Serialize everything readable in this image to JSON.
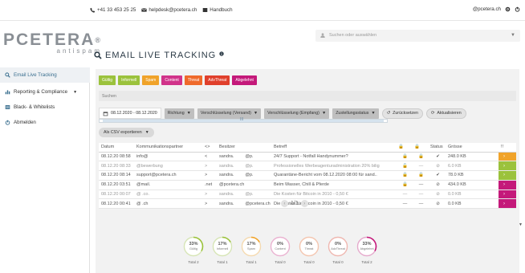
{
  "topbar": {
    "phone": "+41 33 453 25 25",
    "email": "helpdesk@pcetera.ch",
    "manual": "Handbuch",
    "user": "@pcetera.ch"
  },
  "logo": {
    "name": "PCETERA",
    "reg": "®",
    "sub": "antispam"
  },
  "search_select": {
    "placeholder": "Suchen oder auswählen"
  },
  "sidebar": {
    "items": [
      {
        "label": "Email Live Tracking",
        "icon": "search-icon"
      },
      {
        "label": "Reporting & Compliance",
        "icon": "chart-icon"
      },
      {
        "label": "Black- & Whitelists",
        "icon": "list-icon"
      },
      {
        "label": "Abmelden",
        "icon": "power-icon"
      }
    ]
  },
  "page": {
    "title": "EMAIL LIVE TRACKING"
  },
  "chips": [
    {
      "label": "Gültig",
      "color": "#9bc23c"
    },
    {
      "label": "Informell",
      "color": "#9bc23c"
    },
    {
      "label": "Spam",
      "color": "#f0a32a"
    },
    {
      "label": "Content",
      "color": "#d1338a"
    },
    {
      "label": "Threat",
      "color": "#ef6a2b"
    },
    {
      "label": "AdvThreat",
      "color": "#e0402c"
    },
    {
      "label": "Abgelehnt",
      "color": "#c4197a"
    }
  ],
  "search": {
    "placeholder": "Suchen"
  },
  "filters": {
    "date_range": "08.12.2020 - 08.12.2020",
    "direction": "Richtung",
    "enc_send": "Verschlüsselung (Versand)",
    "enc_recv": "Verschlüsselung (Empfang)",
    "delivery_status": "Zustellungsstatus",
    "reset": "Zurücksetzen",
    "refresh": "Aktualisieren",
    "scroll_mark": "III"
  },
  "export": {
    "label": "Als CSV exportieren"
  },
  "table": {
    "headers": [
      "Datum",
      "Kommunikationspartner",
      "<>",
      "Besitzer",
      "Betreff",
      "",
      "",
      "Status",
      "Grösse",
      "!!"
    ],
    "rows": [
      {
        "date": "08.12.20 08:58",
        "partner": "info@",
        "dir": "<",
        "owner": "sandra.",
        "owner_domain": "@p.",
        "subject": "24/7 Support - Notfall Handynummer?",
        "lock1": "🔒",
        "lock2": "🔒",
        "status": "✔",
        "size": "248.0 KB",
        "flag": "#f0a32a",
        "muted": false
      },
      {
        "date": "08.12.20 08:33",
        "partner": "@bewerbung",
        "dir": ">",
        "owner": "sandra.",
        "owner_domain": "@p.",
        "subject": "Professionelles Werbeagenturadministration 20% bilig",
        "lock1": "🔓",
        "lock2": "—",
        "status": "⊘",
        "size": "6.0 KB",
        "flag": "#9bc23c",
        "muted": true
      },
      {
        "date": "08.12.20 08:14",
        "partner": "support@pcetera.ch",
        "dir": ">",
        "owner": "sandra.",
        "owner_domain": "@p.",
        "subject": "Quarantäne-Bericht vom 08.12.2020 08:00 für sand..",
        "lock1": "🔒",
        "lock2": "🔒",
        "status": "✔",
        "size": "78.0 KB",
        "flag": "#9bc23c",
        "muted": false
      },
      {
        "date": "08.12.20 03:51",
        "partner": "@mail.",
        "dir": ".net",
        "owner": "@pcetera.ch",
        "owner_domain": "",
        "subject": "Beim Wasser, Chill & Pferde",
        "lock1": "🔒",
        "lock2": "—",
        "status": "⊘",
        "size": "434.0 KB",
        "flag": "#c4197a",
        "muted": false
      },
      {
        "date": "08.12.20 00:07",
        "partner": "@  .co.",
        "dir": ">",
        "owner": "sandra.",
        "owner_domain": "@p.",
        "subject": "Die Kosten für Bitcoin in 2010 - 0,50 €",
        "lock1": "—",
        "lock2": "—",
        "status": "⊘",
        "size": "0.0 KB",
        "flag": "#c4197a",
        "muted": true
      },
      {
        "date": "08.12.20 00:41",
        "partner": "@   .ch",
        "dir": ">",
        "owner": "sandra.",
        "owner_domain": "@pcetera.ch",
        "subject": "Die Kosten für Bitcoin in 2010 - 0,50 €",
        "lock1": "—",
        "lock2": "—",
        "status": "⊘",
        "size": "0.0 KB",
        "flag": "#c4197a",
        "muted": false
      }
    ]
  },
  "pager": {
    "label": "1/1"
  },
  "gauges": [
    {
      "pct": "33%",
      "fraction": 0.33,
      "cat": "Gültig",
      "total": "Total 2",
      "color": "#9bc23c"
    },
    {
      "pct": "17%",
      "fraction": 0.17,
      "cat": "Informell",
      "total": "Total 1",
      "color": "#9bc23c"
    },
    {
      "pct": "17%",
      "fraction": 0.17,
      "cat": "Spam",
      "total": "Total 1",
      "color": "#f0a32a"
    },
    {
      "pct": "0%",
      "fraction": 0,
      "cat": "Content",
      "total": "Total 0",
      "color": "#d1338a"
    },
    {
      "pct": "0%",
      "fraction": 0,
      "cat": "Threat",
      "total": "Total 0",
      "color": "#ef6a2b"
    },
    {
      "pct": "0%",
      "fraction": 0,
      "cat": "AdvThreat",
      "total": "Total 0",
      "color": "#e0402c"
    },
    {
      "pct": "33%",
      "fraction": 0.33,
      "cat": "Abgelehnt",
      "total": "Total 2",
      "color": "#c4197a"
    }
  ]
}
